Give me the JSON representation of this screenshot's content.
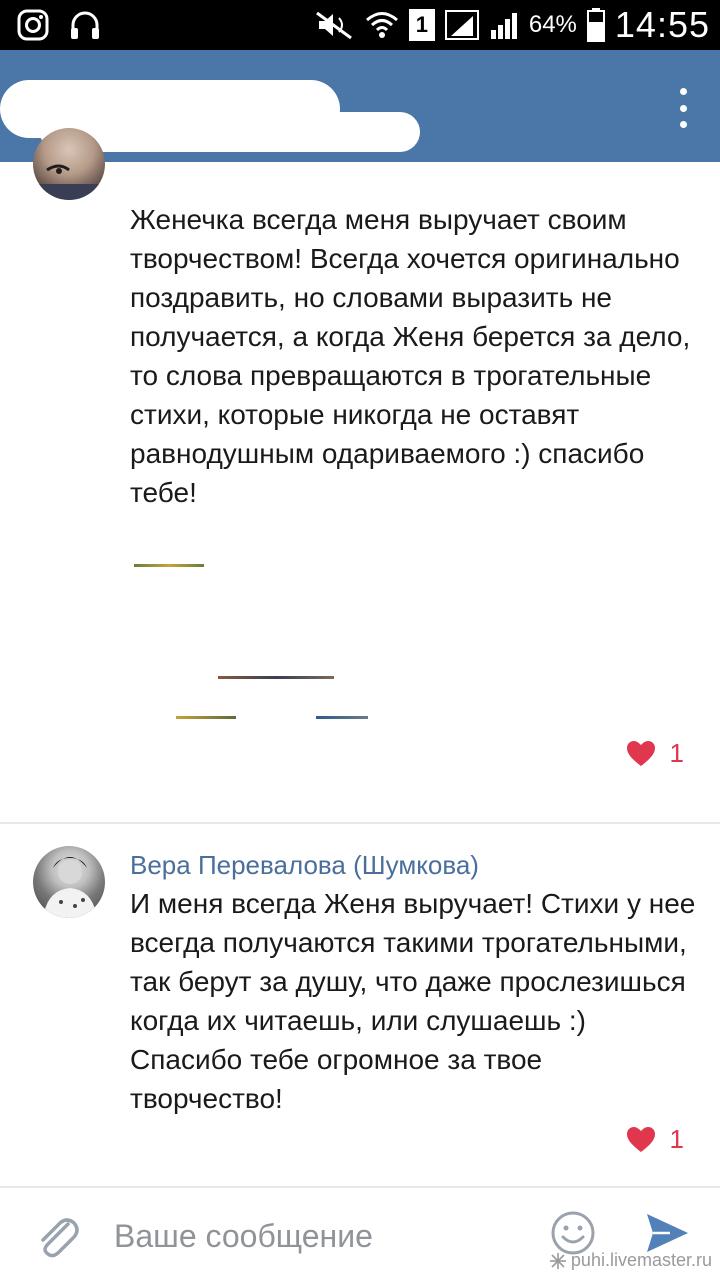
{
  "status_bar": {
    "battery_pct": "64%",
    "time": "14:55",
    "sim_number": "1",
    "icons": [
      "instagram-icon",
      "headphones-icon",
      "mute-icon",
      "wifi-icon",
      "sim-icon",
      "signal-icon",
      "signal-icon",
      "battery-icon"
    ]
  },
  "header": {
    "title": "",
    "menu_icon": "more-vertical-icon",
    "color": "#4a76a8"
  },
  "comments": [
    {
      "author": "",
      "text": "Женечка всегда меня выручает своим творчеством! Всегда хочется оригинально поздравить, но словами выразить не получается, а когда Женя берется за дело, то слова превращаются в трогательные стихи, которые никогда не оставят равнодушным одариваемого :) спасибо тебе!",
      "likes": "1"
    },
    {
      "author": "Вера Перевалова (Шумкова)",
      "text": "И меня всегда Женя выручает! Стихи у нее всегда получаются такими трогательными, так берут за душу, что даже прослезишься когда их читаешь, или слушаешь :) Спасибо тебе огромное за твое творчество!",
      "likes": "1"
    }
  ],
  "composer": {
    "placeholder": "Ваше сообщение",
    "value": "",
    "attach_icon": "paperclip-icon",
    "emoji_icon": "smiley-icon",
    "send_icon": "send-icon"
  },
  "watermark": "puhi.livemaster.ru",
  "colors": {
    "accent": "#4a76a8",
    "like": "#e0374f",
    "author": "#4a6f9c"
  }
}
